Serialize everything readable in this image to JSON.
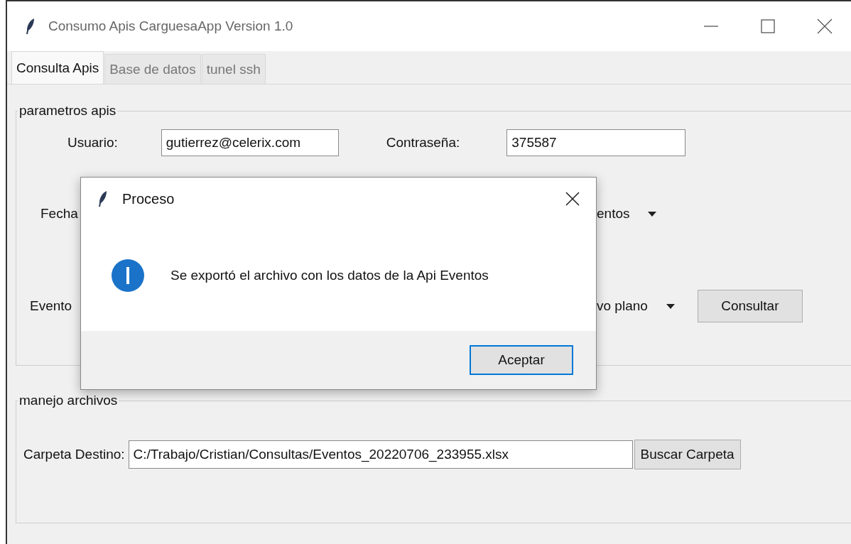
{
  "window": {
    "title": "Consumo Apis CarguesaApp Version 1.0"
  },
  "tabs": [
    {
      "label": "Consulta Apis",
      "selected": true
    },
    {
      "label": "Base de datos",
      "selected": false
    },
    {
      "label": "tunel ssh",
      "selected": false
    }
  ],
  "params_group": {
    "title": "parametros apis",
    "user_label": "Usuario:",
    "user_value": "gutierrez@celerix.com",
    "password_label": "Contraseña:",
    "password_value": "375587",
    "date_label": "Fecha",
    "api_select": "entos",
    "events_label": "Evento",
    "format_select": "vo plano",
    "query_button": "Consultar"
  },
  "files_group": {
    "title": "manejo archivos",
    "folder_label": "Carpeta Destino:",
    "folder_value": "C:/Trabajo/Cristian/Consultas/Eventos_20220706_233955.xlsx",
    "browse_button": "Buscar Carpeta"
  },
  "dialog": {
    "title": "Proceso",
    "message": "Se exportó el archivo con los datos de la Api Eventos",
    "button": "Aceptar"
  }
}
